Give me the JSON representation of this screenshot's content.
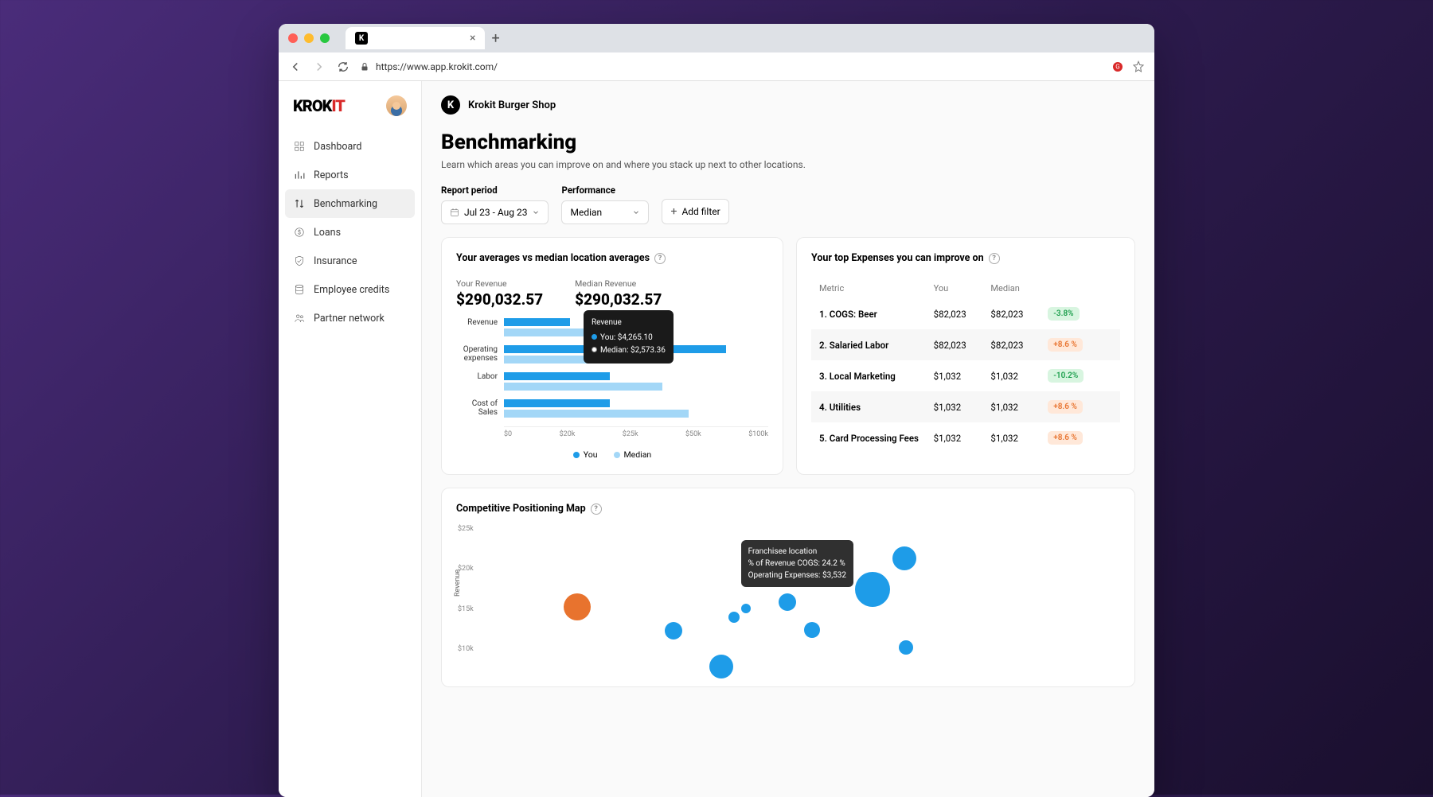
{
  "browser": {
    "url": "https://www.app.krokit.com/",
    "tab_favicon": "K"
  },
  "brand": {
    "part1": "KROK",
    "part2": "IT"
  },
  "sidebar": {
    "items": [
      {
        "label": "Dashboard"
      },
      {
        "label": "Reports"
      },
      {
        "label": "Benchmarking"
      },
      {
        "label": "Loans"
      },
      {
        "label": "Insurance"
      },
      {
        "label": "Employee credits"
      },
      {
        "label": "Partner network"
      }
    ]
  },
  "shop": {
    "name": "Krokit Burger Shop",
    "initial": "K"
  },
  "page": {
    "title": "Benchmarking",
    "subtitle": "Learn which areas you can improve on and where you stack up next to other locations."
  },
  "filters": {
    "period_label": "Report period",
    "period_value": "Jul 23 - Aug 23",
    "perf_label": "Performance",
    "perf_value": "Median",
    "add_filter": "Add filter"
  },
  "avg_card": {
    "title": "Your averages vs median location averages",
    "your_rev_label": "Your Revenue",
    "your_rev_value": "$290,032.57",
    "median_rev_label": "Median Revenue",
    "median_rev_value": "$290,032.57",
    "tooltip": {
      "title": "Revenue",
      "you": "You: $4,265.10",
      "median": "Median: $2,573.36"
    },
    "x_ticks": [
      "$0",
      "$20k",
      "$25k",
      "$50k",
      "$100k"
    ],
    "legend_you": "You",
    "legend_median": "Median"
  },
  "chart_data": {
    "type": "bar",
    "orientation": "horizontal",
    "categories": [
      "Revenue",
      "Operating expenses",
      "Labor",
      "Cost of Sales"
    ],
    "series": [
      {
        "name": "You",
        "color": "#1e9ce8",
        "values": [
          25000,
          84000,
          40000,
          40000
        ]
      },
      {
        "name": "Median",
        "color": "#a3d7f7",
        "values": [
          30000,
          45000,
          60000,
          70000
        ]
      }
    ],
    "xlim": [
      0,
      100000
    ],
    "x_ticks": [
      0,
      20000,
      25000,
      50000,
      100000
    ],
    "xlabel": "",
    "ylabel": ""
  },
  "expenses_card": {
    "title": "Your top Expenses you can improve on",
    "headers": [
      "Metric",
      "You",
      "Median",
      ""
    ],
    "rows": [
      {
        "n": "1.",
        "metric": "COGS: Beer",
        "you": "$82,023",
        "median": "$82,023",
        "delta": "-3.8%",
        "cls": "green"
      },
      {
        "n": "2.",
        "metric": "Salaried Labor",
        "you": "$82,023",
        "median": "$82,023",
        "delta": "+8.6 %",
        "cls": "orange"
      },
      {
        "n": "3.",
        "metric": "Local Marketing",
        "you": "$1,032",
        "median": "$1,032",
        "delta": "-10.2%",
        "cls": "green"
      },
      {
        "n": "4.",
        "metric": "Utilities",
        "you": "$1,032",
        "median": "$1,032",
        "delta": "+8.6 %",
        "cls": "orange"
      },
      {
        "n": "5.",
        "metric": "Card Processing Fees",
        "you": "$1,032",
        "median": "$1,032",
        "delta": "+8.6 %",
        "cls": "orange"
      }
    ]
  },
  "scatter_card": {
    "title": "Competitive Positioning Map",
    "y_ticks": [
      "$25k",
      "$20k",
      "$15k",
      "$10k"
    ],
    "y_label": "Revenue",
    "tooltip": {
      "title": "Franchisee location",
      "line1": "% of Revenue COGS: 24.2 %",
      "line2": "Operating Expenses: $3,532"
    }
  }
}
